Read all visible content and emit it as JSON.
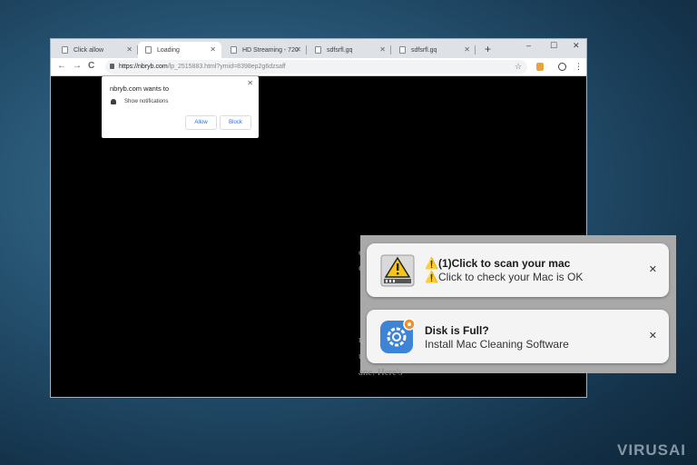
{
  "browser": {
    "tabs": [
      {
        "label": "Click allow"
      },
      {
        "label": "Loading"
      },
      {
        "label": "HD Streaming - 720"
      },
      {
        "label": "sdfsrfl.gq"
      },
      {
        "label": "sdfsrfl.gq"
      }
    ],
    "new_tab": "+",
    "window_controls": {
      "minimize": "–",
      "maximize": "☐",
      "close": "✕"
    },
    "toolbar": {
      "back": "←",
      "forward": "→",
      "reload": "C",
      "url_main": "https://nbryb.com",
      "url_rest": "/lp_2515883.html?ymid=8398ep2g6dzsaff",
      "star": "☆",
      "menu": "⋮"
    }
  },
  "permission_prompt": {
    "title": "nbryb.com wants to",
    "option": "Show notifications",
    "allow": "Allow",
    "block": "Block",
    "close": "✕"
  },
  "page_fragments": [
    "e",
    "Cl",
    "r",
    "u",
    "ane.  Here's"
  ],
  "notifications": [
    {
      "title": "⚠️(1)Click to scan your mac",
      "body": "⚠️Click to check your Mac is OK",
      "close": "✕",
      "icon": "warning-drive-icon"
    },
    {
      "title": "Disk is Full?",
      "body": "Install Mac Cleaning Software",
      "close": "✕",
      "icon": "gear-settings-icon"
    }
  ],
  "watermark": "VIRUSAI",
  "colors": {
    "gear_blue": "#3d84d6",
    "badge_orange": "#f0902a",
    "warning_yellow": "#f5c518"
  }
}
